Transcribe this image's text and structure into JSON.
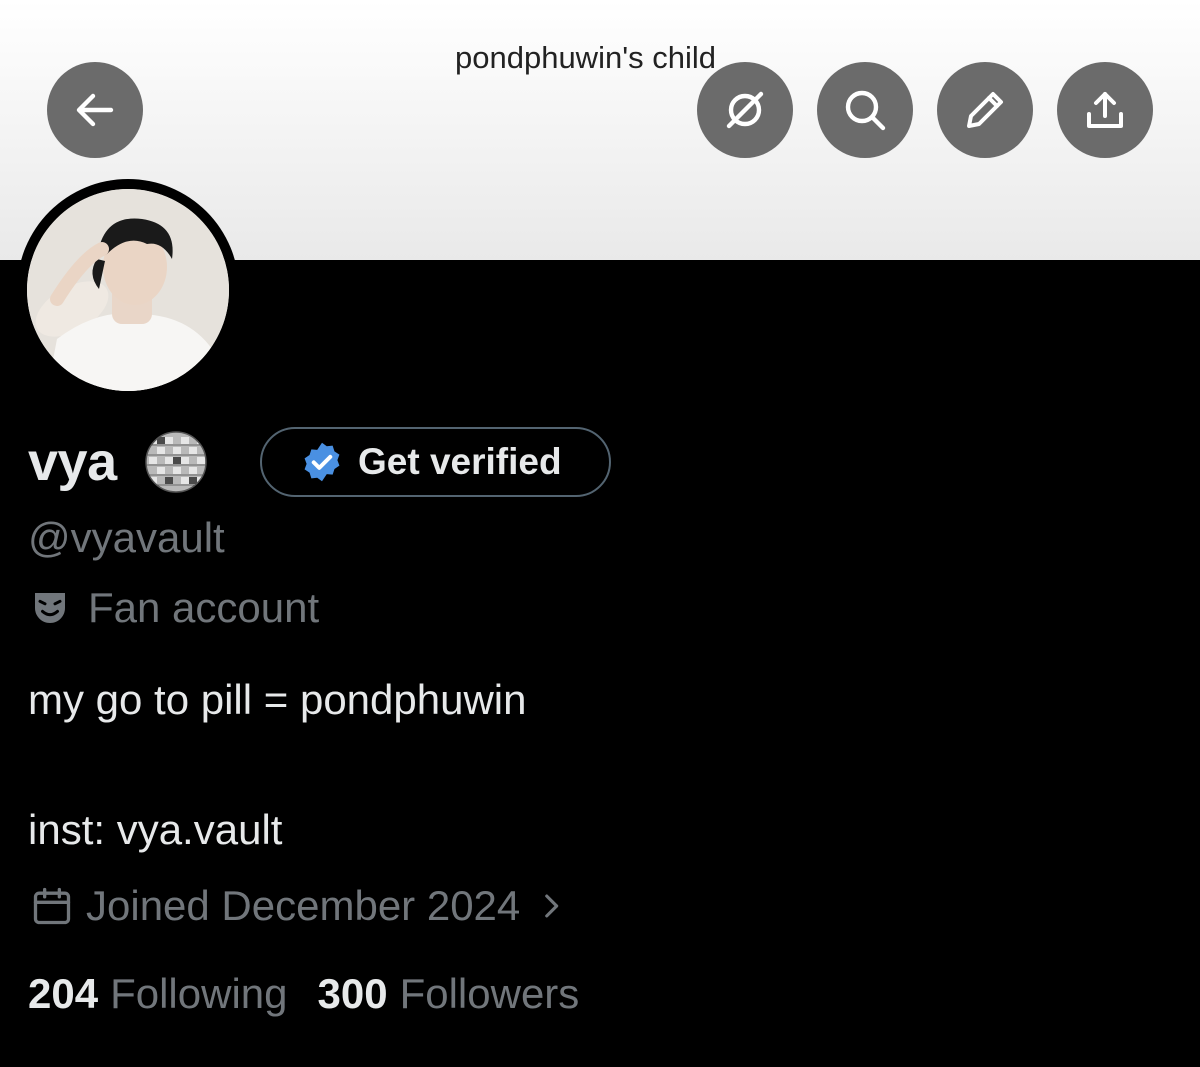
{
  "header": {
    "banner_text": "pondphuwin's child",
    "buttons": [
      {
        "name": "back",
        "icon": "arrow-left-icon"
      },
      {
        "name": "grok",
        "icon": "grok-icon"
      },
      {
        "name": "search",
        "icon": "search-icon"
      },
      {
        "name": "edit",
        "icon": "pencil-icon"
      },
      {
        "name": "share",
        "icon": "share-icon"
      }
    ],
    "button_color": "#6b6b6b"
  },
  "profile": {
    "display_name": "vya",
    "name_emoji": "disco-ball-icon",
    "verify_button_label": "Get verified",
    "handle": "@vyavault",
    "category_icon": "performing-arts-mask-icon",
    "category": "Fan account",
    "bio_line_1": "my go to pill = pondphuwin",
    "bio_line_2": "inst: vya.vault",
    "joined": "Joined December 2024",
    "following_count": "204",
    "following_label": "Following",
    "followers_count": "300",
    "followers_label": "Followers"
  },
  "colors": {
    "background": "#000000",
    "primary_text": "#e7e9ea",
    "secondary_text": "#71767b",
    "verify_badge": "#4a90e2",
    "border": "#536471"
  }
}
